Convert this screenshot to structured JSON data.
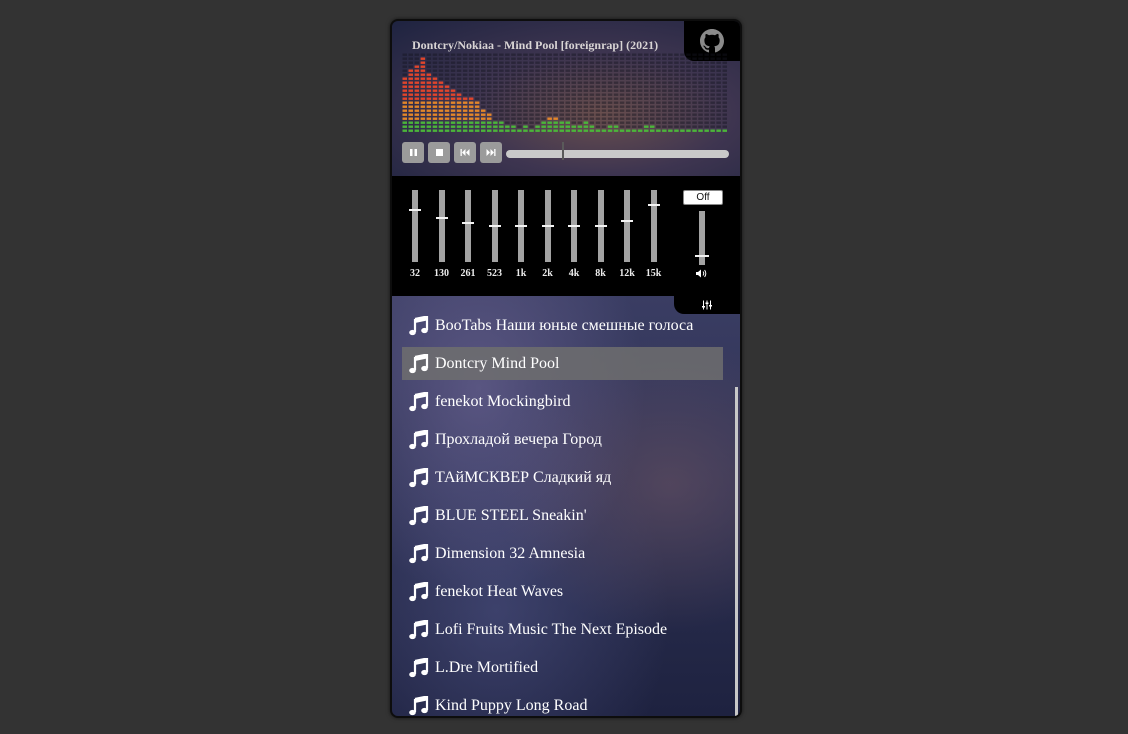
{
  "player": {
    "now_playing": "Dontcry/Nokiaa - Mind Pool [foreignrap] (2021)",
    "controls": {
      "pause_icon": "pause-icon",
      "stop_icon": "stop-icon",
      "prev_icon": "previous-track-icon",
      "next_icon": "next-track-icon"
    },
    "progress": 0.25
  },
  "equalizer": {
    "toggle_label": "Off",
    "bands": [
      {
        "label": "32",
        "level": 0.74
      },
      {
        "label": "130",
        "level": 0.62
      },
      {
        "label": "261",
        "level": 0.55
      },
      {
        "label": "523",
        "level": 0.52
      },
      {
        "label": "1k",
        "level": 0.52
      },
      {
        "label": "2k",
        "level": 0.52
      },
      {
        "label": "4k",
        "level": 0.52
      },
      {
        "label": "8k",
        "level": 0.52
      },
      {
        "label": "12k",
        "level": 0.58
      },
      {
        "label": "15k",
        "level": 0.8
      }
    ],
    "volume": 0.15
  },
  "playlist": {
    "active_index": 1,
    "tracks": [
      "BooTabs Наши юные смешные голоса",
      "Dontcry Mind Pool",
      "fenekot Mockingbird",
      "Прохладой вечера Город",
      "ТАйМСКВЕР Сладкий яд",
      "BLUE STEEL Sneakin'",
      "Dimension 32 Amnesia",
      "fenekot Heat Waves",
      "Lofi Fruits Music The Next Episode",
      "L.Dre Mortified",
      "Kind Puppy Long Road"
    ]
  },
  "colors": {
    "page_bg": "#333333",
    "eq_bg": "#000000",
    "active_row": "#6e6e6e",
    "viz_red": "#e0452b",
    "viz_orange": "#e3862a",
    "viz_green": "#4bb53a"
  }
}
